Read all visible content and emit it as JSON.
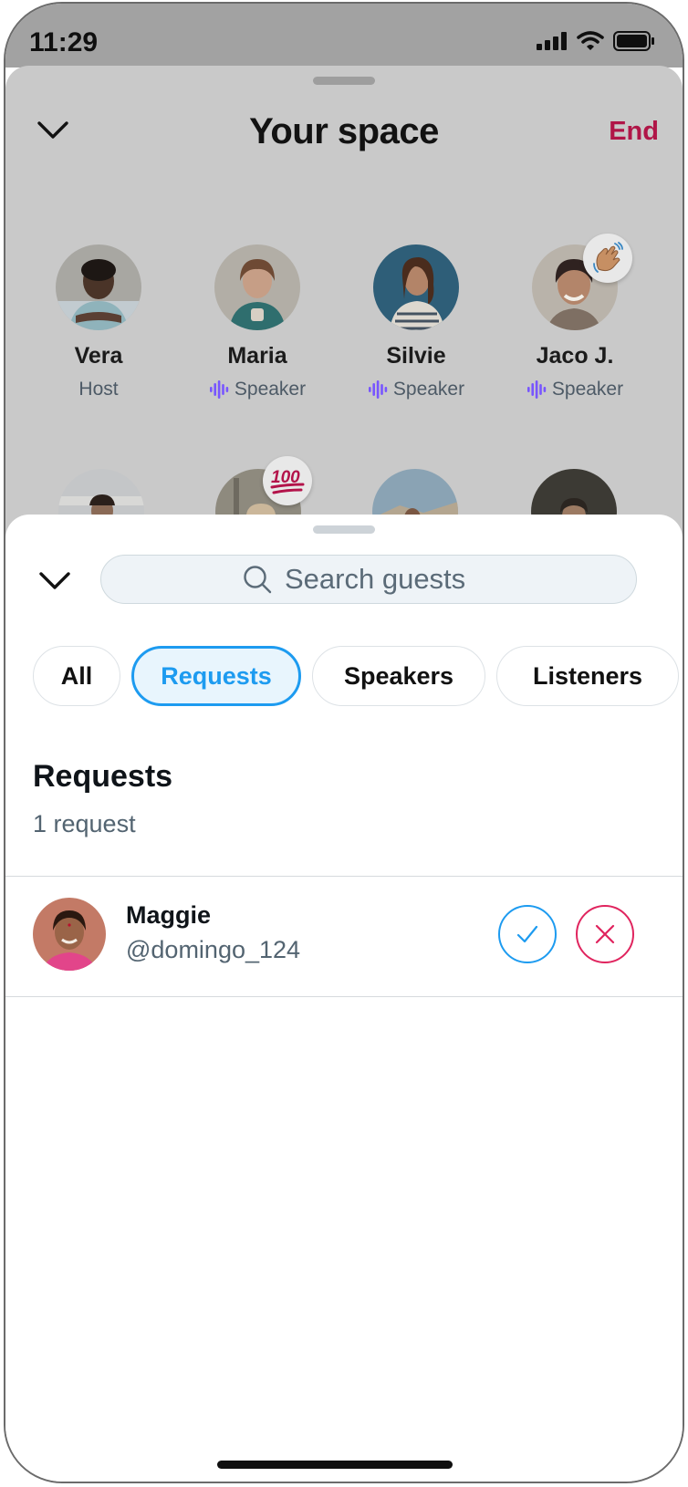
{
  "status_bar": {
    "time": "11:29",
    "icons": [
      "cellular-signal-icon",
      "wifi-icon",
      "battery-icon"
    ]
  },
  "space": {
    "title": "Your space",
    "end_label": "End",
    "participants": [
      {
        "name": "Vera",
        "role": "Host",
        "show_speaker_icon": false
      },
      {
        "name": "Maria",
        "role": "Speaker",
        "show_speaker_icon": true
      },
      {
        "name": "Silvie",
        "role": "Speaker",
        "show_speaker_icon": true
      },
      {
        "name": "Jaco J.",
        "role": "Speaker",
        "show_speaker_icon": true,
        "reaction": "clapping-hands-emoji"
      }
    ],
    "second_row_reactions": [
      "hundred-points-emoji"
    ]
  },
  "guests_sheet": {
    "search": {
      "placeholder": "Search guests",
      "value": ""
    },
    "filters": [
      {
        "label": "All",
        "selected": false
      },
      {
        "label": "Requests",
        "selected": true
      },
      {
        "label": "Speakers",
        "selected": false
      },
      {
        "label": "Listeners",
        "selected": false
      }
    ],
    "section": {
      "title": "Requests",
      "count_text": "1 request"
    },
    "requests": [
      {
        "name": "Maggie",
        "handle": "@domingo_124"
      }
    ]
  },
  "colors": {
    "accent_blue": "#1d9bf0",
    "end_red": "#b01547",
    "decline_pink": "#e0245e",
    "speaker_purple": "#7856ff"
  }
}
